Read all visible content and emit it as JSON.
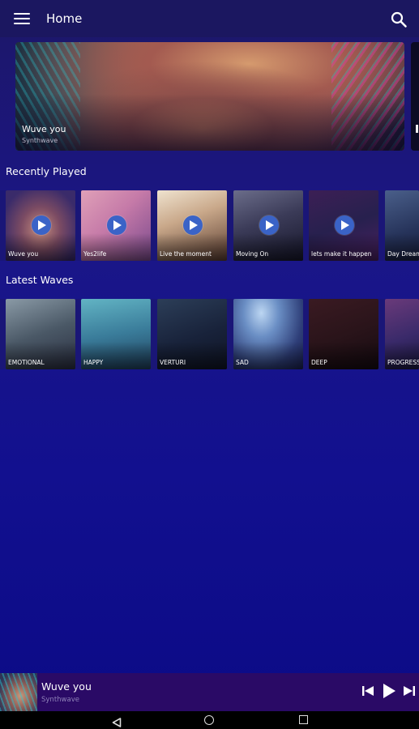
{
  "appbar": {
    "title": "Home",
    "menu_icon": "menu-icon",
    "search_icon": "search-icon"
  },
  "hero": {
    "title": "Wuve you",
    "subtitle": "Synthwave"
  },
  "recently_played": {
    "title": "Recently Played",
    "items": [
      {
        "label": "Wuve you"
      },
      {
        "label": "Yes2life"
      },
      {
        "label": "Live the moment"
      },
      {
        "label": "Moving On"
      },
      {
        "label": "lets make it happen"
      },
      {
        "label": "Day Dream"
      }
    ]
  },
  "latest_waves": {
    "title": "Latest Waves",
    "items": [
      {
        "label": "EMOTIONAL"
      },
      {
        "label": "HAPPY"
      },
      {
        "label": "VERTURI"
      },
      {
        "label": "SAD"
      },
      {
        "label": "DEEP"
      },
      {
        "label": "PROGRESSIVE"
      }
    ]
  },
  "player": {
    "title": "Wuve you",
    "subtitle": "Synthwave"
  },
  "colors": {
    "appbar": "#1b1760",
    "accent": "#3a63c7",
    "player_bg": "#2a0a66"
  }
}
